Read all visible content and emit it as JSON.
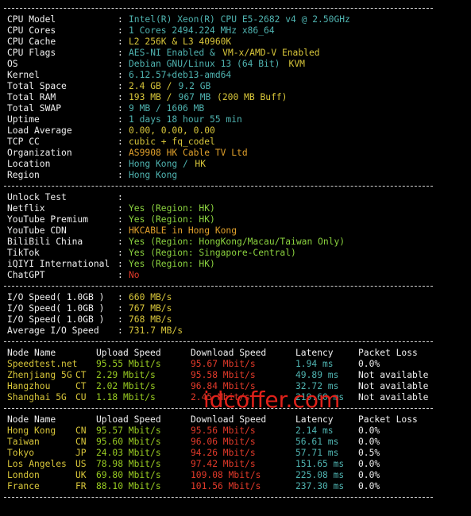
{
  "sysinfo": [
    {
      "label": "CPU Model",
      "v1": "Intel(R) Xeon(R) CPU E5-2682 v4 @ 2.50GHz"
    },
    {
      "label": "CPU Cores",
      "v1": "1 Cores 2494.224 MHz x86_64"
    },
    {
      "label": "CPU Cache",
      "v1": "L2 256K & L3 40960K"
    },
    {
      "label": "CPU Flags",
      "v1": "AES-NI Enabled & ",
      "v2": "VM-x/AMD-V Enabled"
    },
    {
      "label": "OS",
      "v1": "Debian GNU/Linux 13 (64 Bit) ",
      "v2": "KVM"
    },
    {
      "label": "Kernel",
      "v1": "6.12.57+deb13-amd64"
    },
    {
      "label": "Total Space",
      "v1": "2.4 GB / ",
      "v2": "9.2 GB"
    },
    {
      "label": "Total RAM",
      "v1": "193 MB / ",
      "v2": "967 MB",
      "v3": " (200 MB Buff)"
    },
    {
      "label": "Total SWAP",
      "v1": "9 MB / 1606 MB"
    },
    {
      "label": "Uptime",
      "v1": "1 days 18 hour 55 min"
    },
    {
      "label": "Load Average",
      "v1": "0.00, 0.00, 0.00"
    },
    {
      "label": "TCP CC",
      "v1": "cubic + fq_codel"
    },
    {
      "label": "Organization",
      "v1": "AS9908 HK Cable TV Ltd"
    },
    {
      "label": "Location",
      "v1": "Hong Kong / ",
      "v2": "HK"
    },
    {
      "label": "Region",
      "v1": "Hong Kong"
    }
  ],
  "unlock": {
    "header": "Unlock Test",
    "items": [
      {
        "label": "Netflix",
        "value": "Yes (Region: HK)"
      },
      {
        "label": "YouTube Premium",
        "value": "Yes (Region: HK)"
      },
      {
        "label": "YouTube CDN",
        "value": "HKCABLE in Hong Kong"
      },
      {
        "label": "BiliBili China",
        "value": "Yes (Region: HongKong/Macau/Taiwan Only)"
      },
      {
        "label": "TikTok",
        "value": "Yes (Region: Singapore-Central)"
      },
      {
        "label": "iQIYI International",
        "value": "Yes (Region: HK)"
      },
      {
        "label": "ChatGPT",
        "value": "No"
      }
    ]
  },
  "io": [
    {
      "label": "I/O Speed( 1.0GB )",
      "value": "660 MB/s"
    },
    {
      "label": "I/O Speed( 1.0GB )",
      "value": "767 MB/s"
    },
    {
      "label": "I/O Speed( 1.0GB )",
      "value": "768 MB/s"
    },
    {
      "label": "Average I/O Speed",
      "value": "731.7 MB/s"
    }
  ],
  "colon": ":",
  "speed_headers": {
    "node": "Node Name",
    "upload": "Upload Speed",
    "download": "Download Speed",
    "latency": "Latency",
    "loss": "Packet Loss"
  },
  "speed1": [
    {
      "node": "Speedtest.net",
      "cc": "",
      "up": "95.55 Mbit/s",
      "down": "95.67 Mbit/s",
      "lat": "1.94 ms",
      "loss": "0.0%"
    },
    {
      "node": "Zhenjiang 5G",
      "cc": "CT",
      "up": "2.29 Mbit/s",
      "down": "95.58 Mbit/s",
      "lat": "49.89 ms",
      "loss": "Not available"
    },
    {
      "node": "Hangzhou",
      "cc": "CT",
      "up": "2.02 Mbit/s",
      "down": "96.84 Mbit/s",
      "lat": "32.72 ms",
      "loss": "Not available"
    },
    {
      "node": "Shanghai 5G",
      "cc": "CU",
      "up": "1.18 Mbit/s",
      "down": "2.45 Mbit/s",
      "lat": "219.60 ms",
      "loss": "Not available"
    }
  ],
  "speed2": [
    {
      "node": "Hong Kong",
      "cc": "CN",
      "up": "95.57 Mbit/s",
      "down": "95.56 Mbit/s",
      "lat": "2.14 ms",
      "loss": "0.0%"
    },
    {
      "node": "Taiwan",
      "cc": "CN",
      "up": "95.60 Mbit/s",
      "down": "96.06 Mbit/s",
      "lat": "56.61 ms",
      "loss": "0.0%"
    },
    {
      "node": "Tokyo",
      "cc": "JP",
      "up": "24.03 Mbit/s",
      "down": "94.26 Mbit/s",
      "lat": "57.71 ms",
      "loss": "0.5%"
    },
    {
      "node": "Los Angeles",
      "cc": "US",
      "up": "78.98 Mbit/s",
      "down": "97.42 Mbit/s",
      "lat": "151.65 ms",
      "loss": "0.0%"
    },
    {
      "node": "London",
      "cc": "UK",
      "up": "69.80 Mbit/s",
      "down": "109.08 Mbit/s",
      "lat": "225.08 ms",
      "loss": "0.0%"
    },
    {
      "node": "France",
      "cc": "FR",
      "up": "88.10 Mbit/s",
      "down": "101.56 Mbit/s",
      "lat": "237.30 ms",
      "loss": "0.0%"
    }
  ],
  "watermark": "idcoffer.com",
  "colors": {
    "background": "#000000",
    "label": "#e9e9e9",
    "cyan": "#4fb3b0",
    "yellow": "#d8c63a",
    "orange": "#e1a12b",
    "green": "#8bd33f",
    "red": "#e33a2a",
    "watermark": "#e0211a"
  }
}
